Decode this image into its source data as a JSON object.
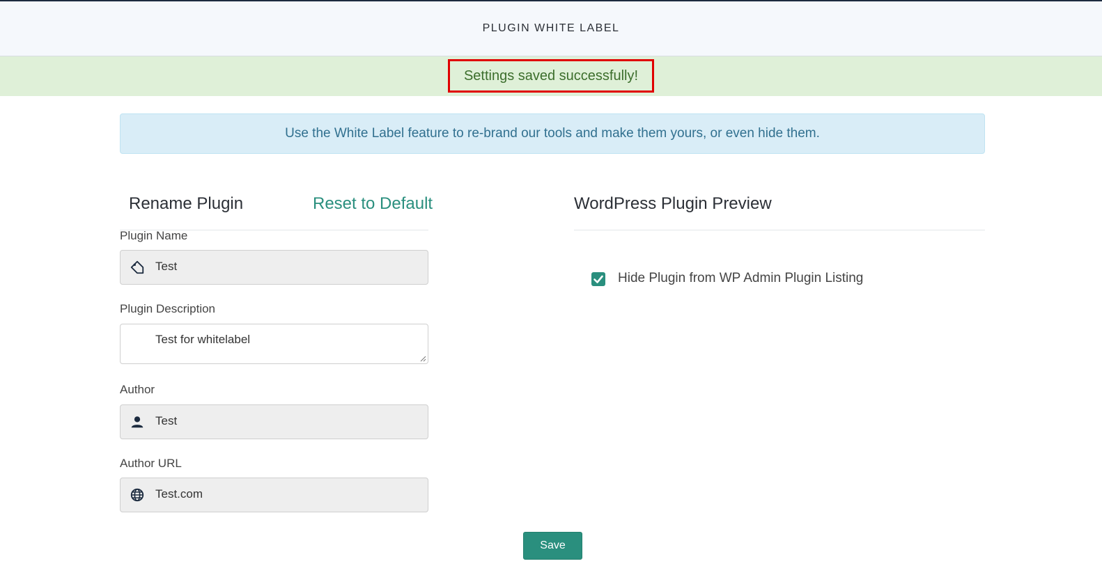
{
  "header": {
    "title": "PLUGIN WHITE LABEL"
  },
  "alert": {
    "success_message": "Settings saved successfully!"
  },
  "info": {
    "message": "Use the White Label feature to re-brand our tools and make them yours, or even hide them."
  },
  "rename": {
    "title": "Rename Plugin",
    "reset_label": "Reset to Default",
    "fields": {
      "plugin_name": {
        "label": "Plugin Name",
        "value": "Test",
        "icon": "tag-icon"
      },
      "plugin_description": {
        "label": "Plugin Description",
        "value": "Test for whitelabel"
      },
      "author": {
        "label": "Author",
        "value": "Test",
        "icon": "person-icon"
      },
      "author_url": {
        "label": "Author URL",
        "value": "Test.com",
        "icon": "globe-icon"
      }
    }
  },
  "preview": {
    "title": "WordPress Plugin Preview",
    "hide_plugin_label": "Hide Plugin from WP Admin Plugin Listing",
    "hide_plugin_checked": true
  },
  "actions": {
    "save_label": "Save"
  },
  "colors": {
    "accent": "#2a8f7e",
    "success_bg": "#dff0d8",
    "success_text": "#3c6e2c",
    "highlight_border": "#e00000",
    "info_bg": "#d9edf7",
    "info_text": "#31708f",
    "icon_dark": "#1c2b3f"
  }
}
